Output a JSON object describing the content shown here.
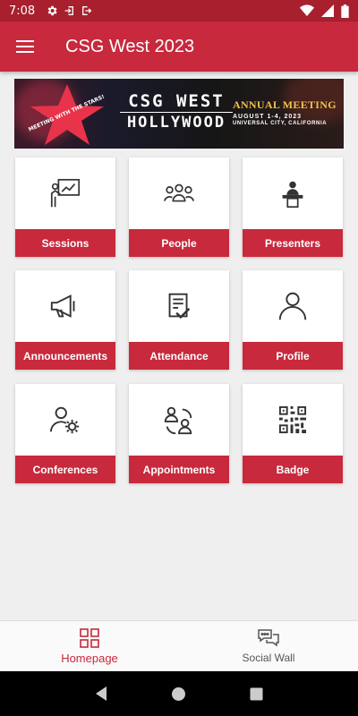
{
  "status_bar": {
    "time": "7:08"
  },
  "app_bar": {
    "title": "CSG West 2023"
  },
  "banner": {
    "star_text": "MEETING WITH THE STARS!",
    "line1": "CSG WEST",
    "line2": "HOLLYWOOD",
    "event": "ANNUAL MEETING",
    "dates": "AUGUST 1-4, 2023",
    "location": "UNIVERSAL CITY, CALIFORNIA"
  },
  "tiles": [
    {
      "label": "Sessions",
      "icon": "presentation-board-icon"
    },
    {
      "label": "People",
      "icon": "people-group-icon"
    },
    {
      "label": "Presenters",
      "icon": "podium-speaker-icon"
    },
    {
      "label": "Announcements",
      "icon": "megaphone-icon"
    },
    {
      "label": "Attendance",
      "icon": "clipboard-check-icon"
    },
    {
      "label": "Profile",
      "icon": "person-icon"
    },
    {
      "label": "Conferences",
      "icon": "person-gear-icon"
    },
    {
      "label": "Appointments",
      "icon": "people-connect-icon"
    },
    {
      "label": "Badge",
      "icon": "qr-code-icon"
    }
  ],
  "bottom_nav": {
    "items": [
      {
        "label": "Homepage",
        "active": true
      },
      {
        "label": "Social Wall",
        "active": false
      }
    ]
  },
  "colors": {
    "brand": "#c8293c",
    "status_bar": "#a8202e",
    "background": "#efefef"
  }
}
